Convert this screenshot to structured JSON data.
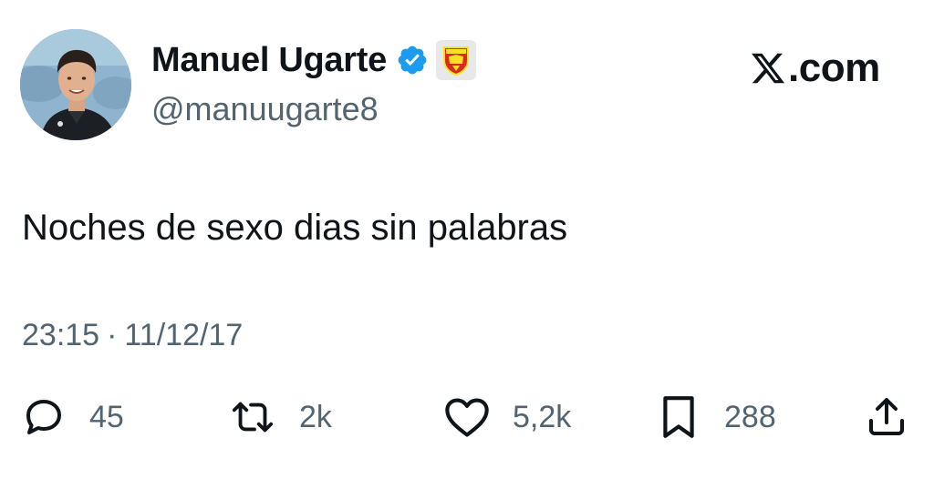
{
  "author": {
    "name": "Manuel Ugarte",
    "handle": "@manuugarte8"
  },
  "site": {
    "logo_text": ".com"
  },
  "tweet": {
    "text": "Noches de sexo dias sin palabras",
    "time": "23:15",
    "separator": "·",
    "date": "11/12/17"
  },
  "actions": {
    "replies": "45",
    "retweets": "2k",
    "likes": "5,2k",
    "bookmarks": "288"
  },
  "colors": {
    "text_primary": "#0f1419",
    "text_secondary": "#536471",
    "verified_blue": "#1d9bf0",
    "club_red": "#da291c",
    "club_yellow": "#fbe122"
  },
  "icons": {
    "verified": "verified-badge-icon",
    "club": "manchester-united-crest-icon",
    "reply": "speech-bubble-icon",
    "retweet": "retweet-arrows-icon",
    "like": "heart-icon",
    "bookmark": "bookmark-icon",
    "share": "share-upload-icon",
    "site": "x-logo-icon"
  }
}
